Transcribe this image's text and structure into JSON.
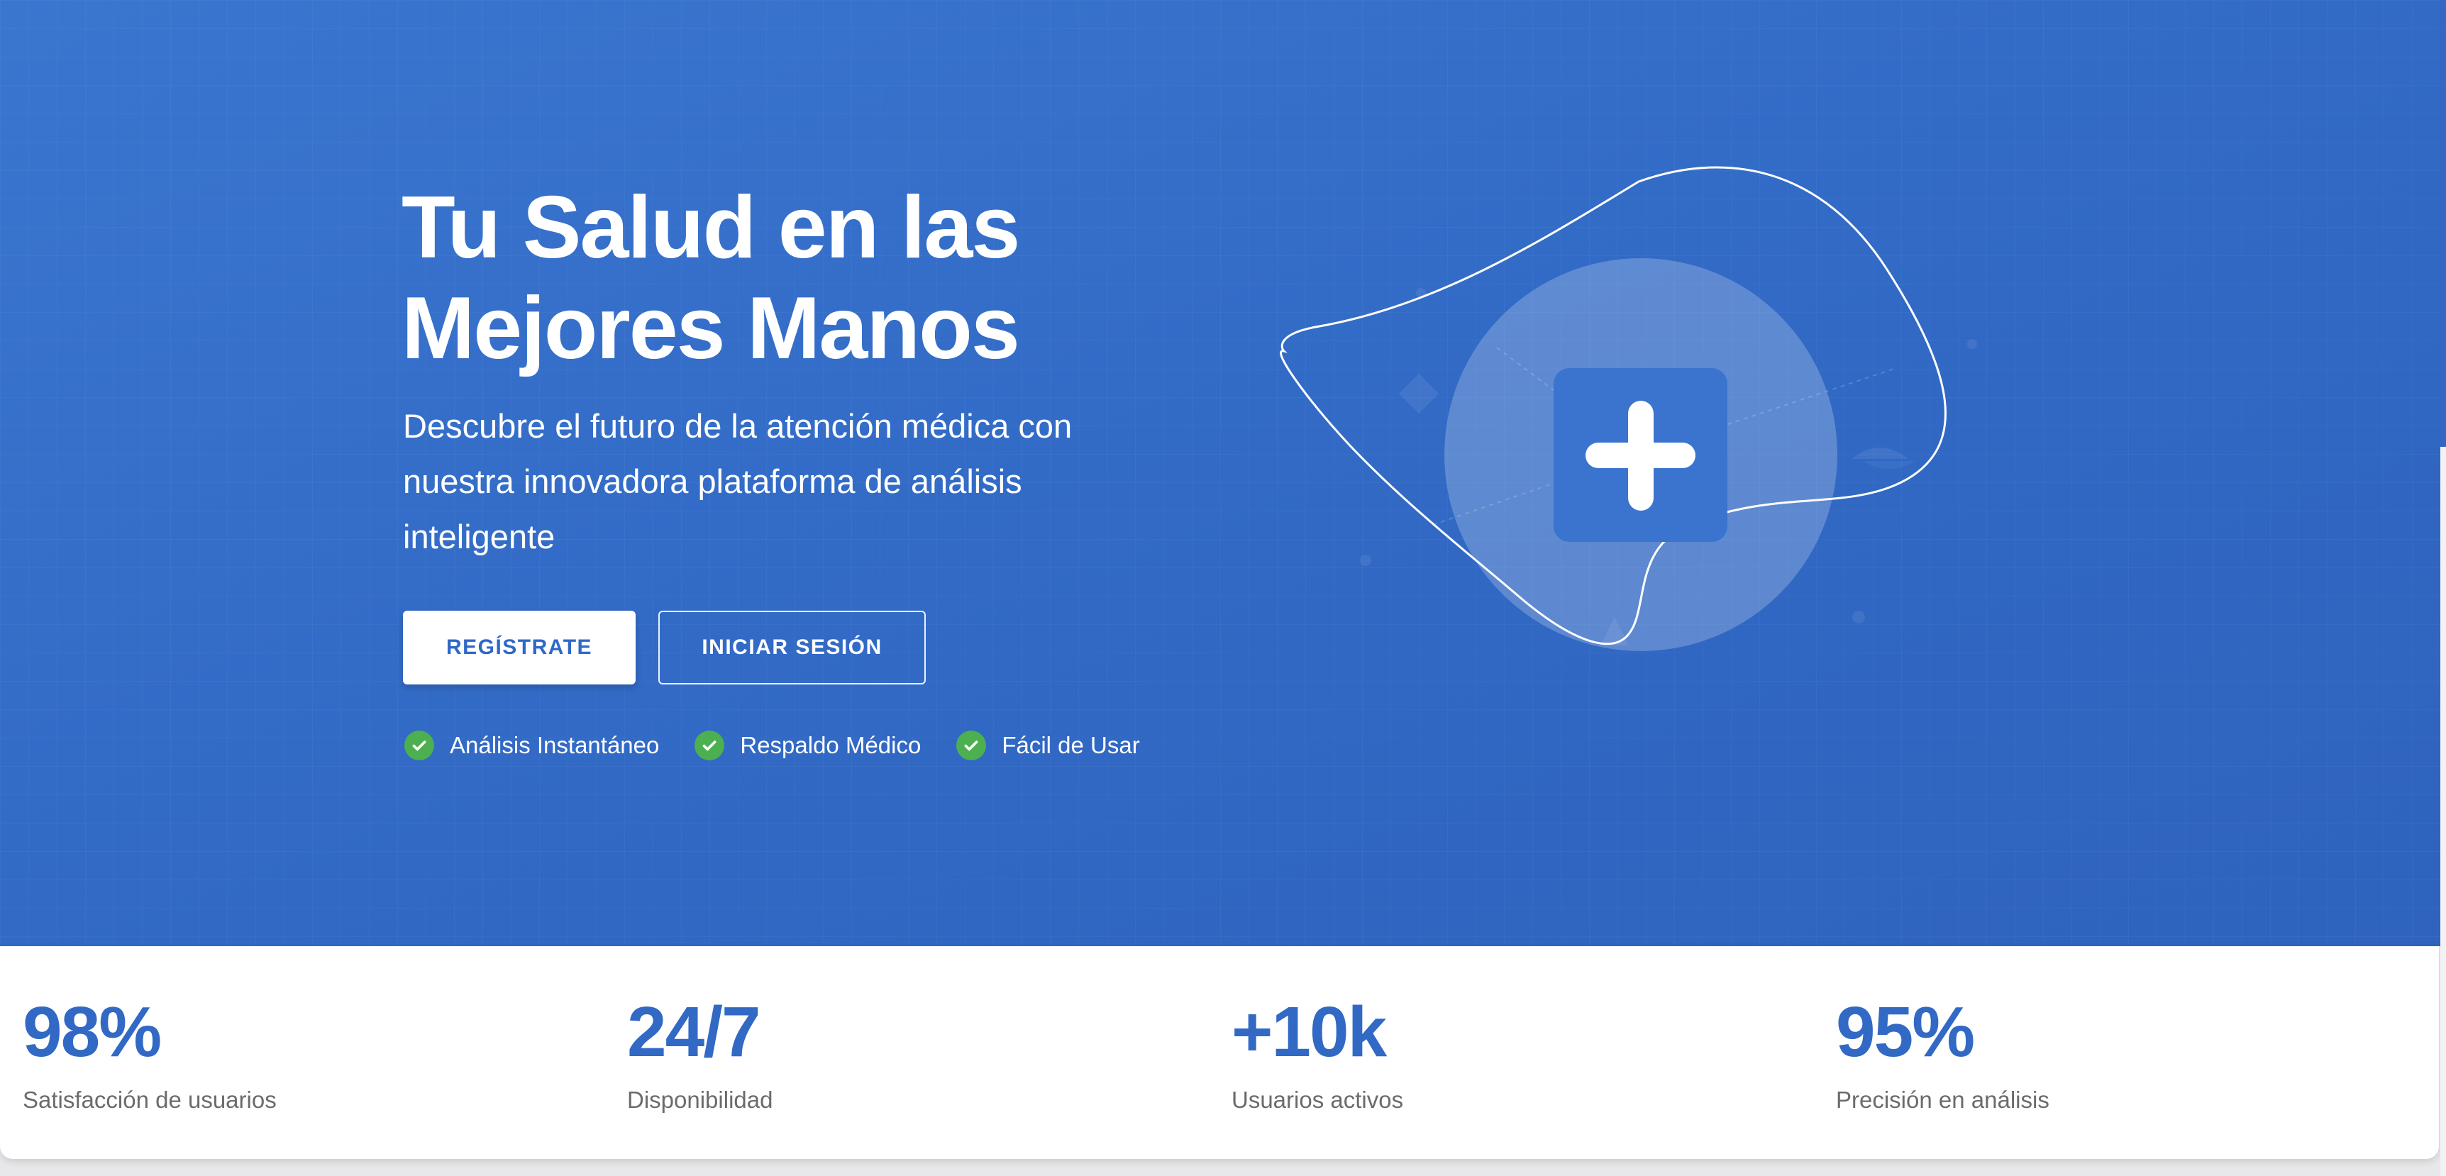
{
  "hero": {
    "title_line1": "Tu Salud en las",
    "title_line2": "Mejores Manos",
    "subtitle": "Descubre el futuro de la atención médica con nuestra innovadora plataforma de análisis inteligente",
    "register_label": "REGÍSTRATE",
    "login_label": "INICIAR SESIÓN",
    "features": [
      {
        "label": "Análisis Instantáneo",
        "icon": "check-circle-icon"
      },
      {
        "label": "Respaldo Médico",
        "icon": "check-circle-icon"
      },
      {
        "label": "Fácil de Usar",
        "icon": "check-circle-icon"
      }
    ],
    "illustration_icon": "medical-plus-icon"
  },
  "stats": [
    {
      "value": "98%",
      "label": "Satisfacción de usuarios"
    },
    {
      "value": "24/7",
      "label": "Disponibilidad"
    },
    {
      "value": "+10k",
      "label": "Usuarios activos"
    },
    {
      "value": "95%",
      "label": "Precisión en análisis"
    }
  ],
  "colors": {
    "primary": "#3169c5",
    "hero_bg": "#3670c9",
    "check_green": "#4caf50",
    "white": "#ffffff",
    "muted_text": "#6b6b6b"
  }
}
